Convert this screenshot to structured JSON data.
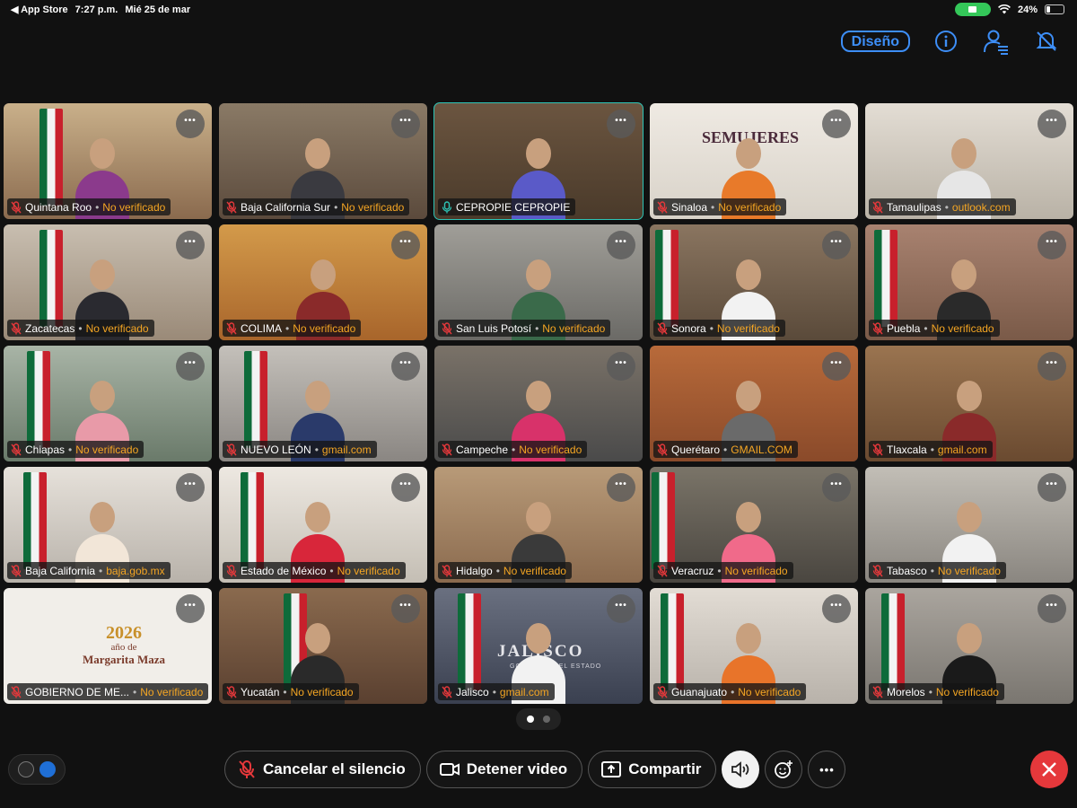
{
  "status_bar": {
    "back_app": "◀ App Store",
    "time": "7:27 p.m.",
    "date": "Mié 25 de mar",
    "battery": "24%",
    "battery_level": 0.24
  },
  "toolbar": {
    "layout_label": "Diseño",
    "icons": [
      "info-icon",
      "participants-icon",
      "notifications-off-icon"
    ]
  },
  "participants": [
    {
      "name": "Quintana Roo",
      "status": "No verificado",
      "muted": true
    },
    {
      "name": "Baja California Sur",
      "status": "No verificado",
      "muted": true
    },
    {
      "name": "CEPROPIE CEPROPIE",
      "status": "",
      "muted": false,
      "active": true
    },
    {
      "name": "Sinaloa",
      "status": "No verificado",
      "muted": true
    },
    {
      "name": "Tamaulipas",
      "status": "outlook.com",
      "muted": true
    },
    {
      "name": "Zacatecas",
      "status": "No verificado",
      "muted": true
    },
    {
      "name": "COLIMA",
      "status": "No verificado",
      "muted": true
    },
    {
      "name": "San Luis Potosí",
      "status": "No verificado",
      "muted": true
    },
    {
      "name": "Sonora",
      "status": "No verificado",
      "muted": true
    },
    {
      "name": "Puebla",
      "status": "No verificado",
      "muted": true
    },
    {
      "name": "Chiapas",
      "status": "No verificado",
      "muted": true
    },
    {
      "name": "NUEVO LEÓN",
      "status": "gmail.com",
      "muted": true
    },
    {
      "name": "Campeche",
      "status": "No verificado",
      "muted": true
    },
    {
      "name": "Querétaro",
      "status": "GMAIL.COM",
      "muted": true
    },
    {
      "name": "Tlaxcala",
      "status": "gmail.com",
      "muted": true
    },
    {
      "name": "Baja California",
      "status": "baja.gob.mx",
      "muted": true
    },
    {
      "name": "Estado de México",
      "status": "No verificado",
      "muted": true
    },
    {
      "name": "Hidalgo",
      "status": "No verificado",
      "muted": true
    },
    {
      "name": "Veracruz",
      "status": "No verificado",
      "muted": true
    },
    {
      "name": "Tabasco",
      "status": "No verificado",
      "muted": true
    },
    {
      "name": "GOBIERNO DE ME...",
      "status": "No verificado",
      "muted": true
    },
    {
      "name": "Yucatán",
      "status": "No verificado",
      "muted": true
    },
    {
      "name": "Jalisco",
      "status": "gmail.com",
      "muted": true
    },
    {
      "name": "Guanajuato",
      "status": "No verificado",
      "muted": true
    },
    {
      "name": "Morelos",
      "status": "No verificado",
      "muted": true
    }
  ],
  "tile_text": {
    "semujeres": "SEMUJERES",
    "year": "2026",
    "year_caption": "año de",
    "year_name": "Margarita Maza",
    "jalisco": "JALISCO",
    "jalisco_sub": "GOBIERNO DEL ESTADO"
  },
  "pager": {
    "pages": 2,
    "current": 1
  },
  "controls": {
    "unmute_label": "Cancelar el silencio",
    "stop_video_label": "Detener video",
    "share_label": "Compartir",
    "more_symbol": "•••"
  },
  "colors": {
    "accent_blue": "#3d8ef7",
    "active_outline": "#2ec4b6",
    "unverified": "#f5a623",
    "end_call": "#e5383b",
    "camera_on": "#34c759"
  }
}
